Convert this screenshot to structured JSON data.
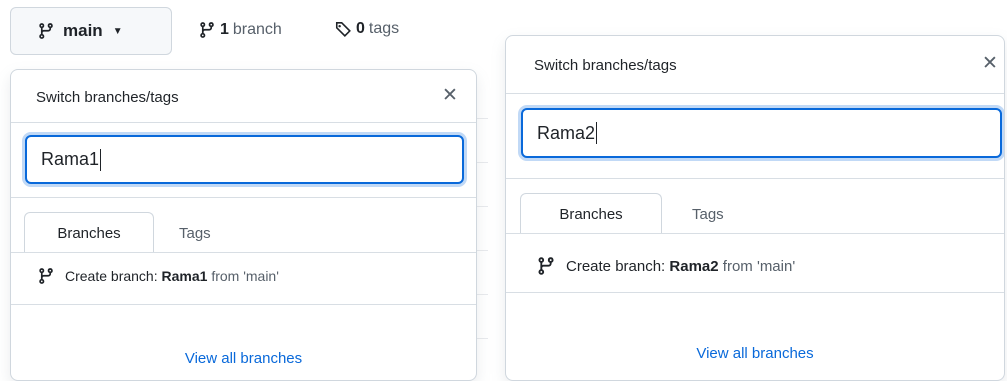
{
  "top_bar": {
    "branch_button_label": "main",
    "branches_count": "1",
    "branches_label": "branch",
    "tags_count": "0",
    "tags_label": "tags"
  },
  "panels": [
    {
      "title": "Switch branches/tags",
      "filter_value": "Rama1",
      "tabs": [
        "Branches",
        "Tags"
      ],
      "active_tab": "Branches",
      "create_prefix": "Create branch:",
      "create_branch_name": "Rama1",
      "create_suffix": "from 'main'",
      "view_all_label": "View all branches"
    },
    {
      "title": "Switch branches/tags",
      "filter_value": "Rama2",
      "tabs": [
        "Branches",
        "Tags"
      ],
      "active_tab": "Branches",
      "create_prefix": "Create branch:",
      "create_branch_name": "Rama2",
      "create_suffix": "from 'main'",
      "view_all_label": "View all branches"
    }
  ],
  "colors": {
    "accent": "#0969da",
    "border": "#d0d7de",
    "muted": "#57606a"
  },
  "icons": [
    "git-branch-icon",
    "chevron-down-icon",
    "tag-icon",
    "close-icon"
  ]
}
